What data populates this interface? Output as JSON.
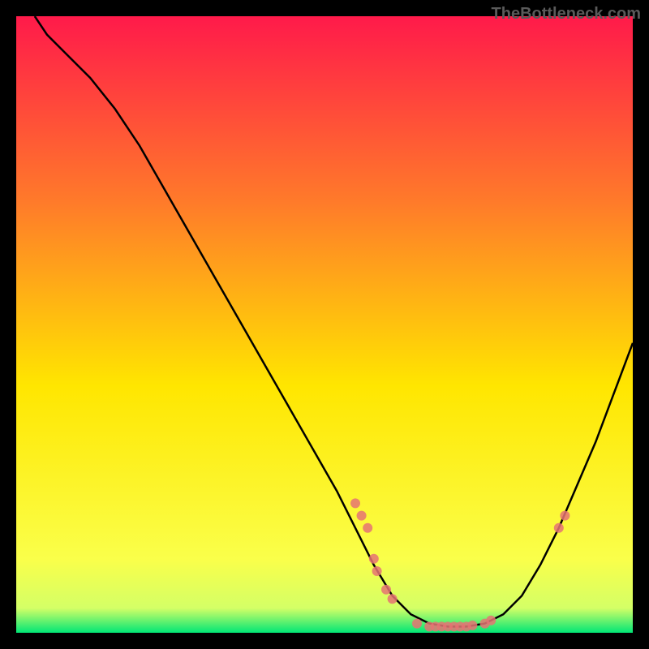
{
  "watermark": "TheBottleneck.com",
  "chart_data": {
    "type": "line",
    "title": "",
    "xlabel": "",
    "ylabel": "",
    "xlim": [
      0,
      100
    ],
    "ylim": [
      0,
      100
    ],
    "gradient_bg": {
      "top": "#ff1a4a",
      "mid1": "#ff7a2a",
      "mid2": "#ffe600",
      "mid3": "#faff4a",
      "bottom_band": "#00e676"
    },
    "curve": [
      {
        "x": 3,
        "y": 100
      },
      {
        "x": 5,
        "y": 97
      },
      {
        "x": 8,
        "y": 94
      },
      {
        "x": 12,
        "y": 90
      },
      {
        "x": 16,
        "y": 85
      },
      {
        "x": 20,
        "y": 79
      },
      {
        "x": 24,
        "y": 72
      },
      {
        "x": 28,
        "y": 65
      },
      {
        "x": 32,
        "y": 58
      },
      {
        "x": 36,
        "y": 51
      },
      {
        "x": 40,
        "y": 44
      },
      {
        "x": 44,
        "y": 37
      },
      {
        "x": 48,
        "y": 30
      },
      {
        "x": 52,
        "y": 23
      },
      {
        "x": 55,
        "y": 17
      },
      {
        "x": 58,
        "y": 11
      },
      {
        "x": 61,
        "y": 6
      },
      {
        "x": 64,
        "y": 3
      },
      {
        "x": 67,
        "y": 1.5
      },
      {
        "x": 70,
        "y": 1
      },
      {
        "x": 73,
        "y": 1
      },
      {
        "x": 76,
        "y": 1.5
      },
      {
        "x": 79,
        "y": 3
      },
      {
        "x": 82,
        "y": 6
      },
      {
        "x": 85,
        "y": 11
      },
      {
        "x": 88,
        "y": 17
      },
      {
        "x": 91,
        "y": 24
      },
      {
        "x": 94,
        "y": 31
      },
      {
        "x": 97,
        "y": 39
      },
      {
        "x": 100,
        "y": 47
      }
    ],
    "scatter": [
      {
        "x": 55,
        "y": 21
      },
      {
        "x": 56,
        "y": 19
      },
      {
        "x": 57,
        "y": 17
      },
      {
        "x": 58,
        "y": 12
      },
      {
        "x": 58.5,
        "y": 10
      },
      {
        "x": 60,
        "y": 7
      },
      {
        "x": 61,
        "y": 5.5
      },
      {
        "x": 65,
        "y": 1.5
      },
      {
        "x": 67,
        "y": 1
      },
      {
        "x": 68,
        "y": 1
      },
      {
        "x": 69,
        "y": 1
      },
      {
        "x": 70,
        "y": 1
      },
      {
        "x": 71,
        "y": 1
      },
      {
        "x": 72,
        "y": 1
      },
      {
        "x": 73,
        "y": 1
      },
      {
        "x": 74,
        "y": 1.2
      },
      {
        "x": 76,
        "y": 1.5
      },
      {
        "x": 77,
        "y": 2
      },
      {
        "x": 88,
        "y": 17
      },
      {
        "x": 89,
        "y": 19
      }
    ]
  }
}
